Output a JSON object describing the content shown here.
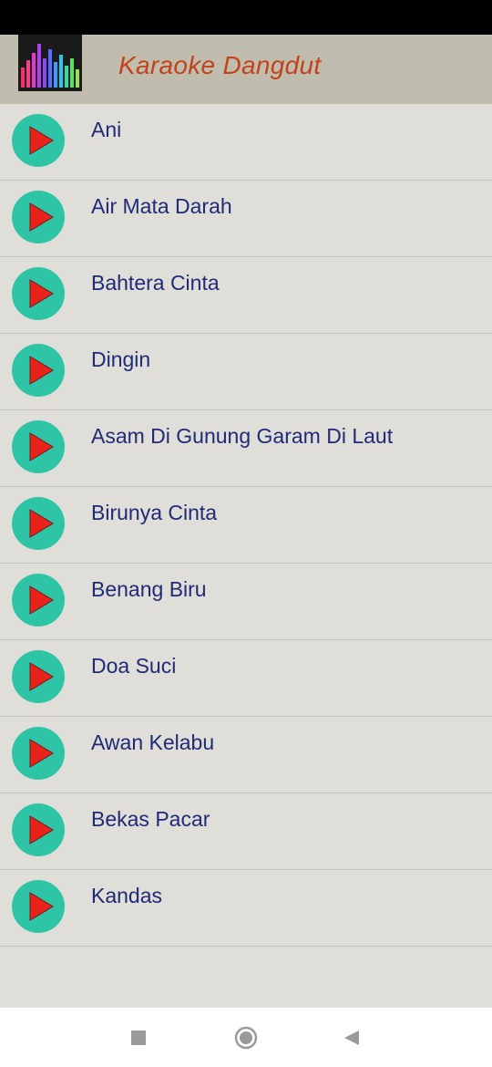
{
  "app": {
    "title": "Karaoke Dangdut",
    "title_color": "#c2421a"
  },
  "songs": [
    {
      "title": "Ani"
    },
    {
      "title": "Air Mata Darah"
    },
    {
      "title": "Bahtera Cinta"
    },
    {
      "title": "Dingin"
    },
    {
      "title": "Asam Di Gunung Garam Di Laut"
    },
    {
      "title": "Birunya Cinta"
    },
    {
      "title": "Benang Biru"
    },
    {
      "title": "Doa Suci"
    },
    {
      "title": "Awan Kelabu"
    },
    {
      "title": "Bekas Pacar"
    },
    {
      "title": "Kandas"
    }
  ],
  "icons": {
    "play": "play-icon",
    "recent": "square-icon",
    "home": "circle-icon",
    "back": "triangle-back-icon"
  },
  "colors": {
    "play_circle": "#2ec4a6",
    "play_triangle": "#e8231a",
    "song_text": "#1f2a78",
    "app_bar": "#c1bdae",
    "background": "#e0ded8"
  }
}
